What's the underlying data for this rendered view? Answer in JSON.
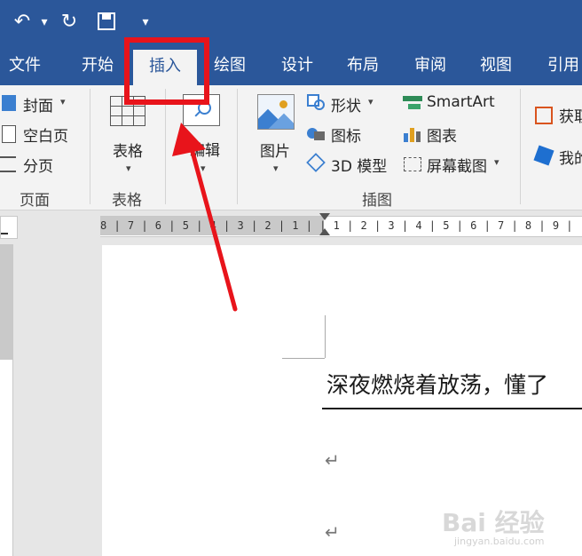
{
  "quick_access": {
    "undo_icon": "undo-icon",
    "redo_icon": "redo-icon",
    "save_icon": "save-icon",
    "customize_icon": "customize-toolbar-icon"
  },
  "tabs": [
    {
      "label": "文件"
    },
    {
      "label": "开始"
    },
    {
      "label": "插入",
      "active": true
    },
    {
      "label": "绘图"
    },
    {
      "label": "设计"
    },
    {
      "label": "布局"
    },
    {
      "label": "审阅"
    },
    {
      "label": "视图"
    },
    {
      "label": "引用"
    }
  ],
  "ribbon": {
    "pages": {
      "cover": "封面",
      "blank": "空白页",
      "break": "分页",
      "group": "页面"
    },
    "tables": {
      "table": "表格",
      "group": "表格"
    },
    "edit": {
      "label": "编辑"
    },
    "illustrations": {
      "picture": "图片",
      "shapes": "形状",
      "icons": "图标",
      "model3d": "3D 模型",
      "smartart": "SmartArt",
      "chart": "图表",
      "screenshot": "屏幕截图",
      "group": "插图"
    },
    "addins": {
      "get": "获取",
      "my": "我的"
    }
  },
  "ruler": {
    "marks": "8 | 7 | 6 | 5 | 4 | 3 | 2 | 1 |   | 1 | 2 | 3 | 4 | 5 | 6 | 7 | 8 | 9 |"
  },
  "document": {
    "line1": "深夜燃烧着放荡，懂了",
    "para_mark": "↵"
  },
  "watermark": {
    "brand": "Bai 经验",
    "url": "jingyan.baidu.com"
  },
  "colors": {
    "accent": "#2b579a",
    "annotation": "#e8141b"
  }
}
